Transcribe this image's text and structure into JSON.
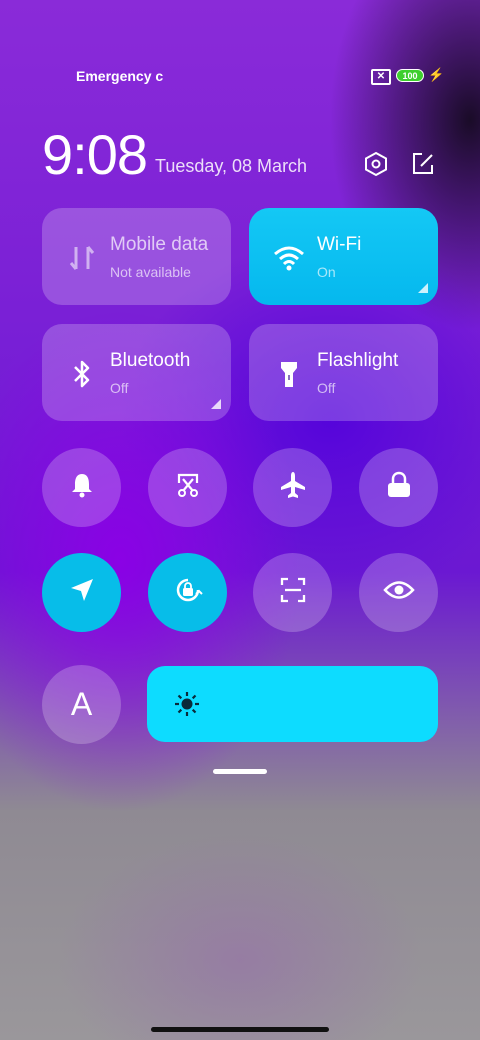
{
  "status_bar": {
    "carrier_text": "Emergency c",
    "sim_icon": "sim-error-icon",
    "battery_level": "100",
    "charging_icon": "charging-bolt-icon"
  },
  "header": {
    "time": "9:08",
    "date": "Tuesday, 08 March",
    "settings_icon": "settings-hexagon-icon",
    "edit_icon": "edit-icon"
  },
  "tiles": [
    {
      "label": "Mobile data",
      "sub": "Not available",
      "icon": "mobile-data-icon",
      "state": "disabled"
    },
    {
      "label": "Wi-Fi",
      "sub": "On",
      "icon": "wifi-icon",
      "state": "on"
    },
    {
      "label": "Bluetooth",
      "sub": "Off",
      "icon": "bluetooth-icon",
      "state": "off"
    },
    {
      "label": "Flashlight",
      "sub": "Off",
      "icon": "flashlight-icon",
      "state": "off"
    }
  ],
  "toggles_row1": [
    {
      "icon": "bell-icon",
      "state": "off"
    },
    {
      "icon": "screenshot-scissors-icon",
      "state": "off"
    },
    {
      "icon": "airplane-icon",
      "state": "off"
    },
    {
      "icon": "lock-icon",
      "state": "off"
    }
  ],
  "toggles_row2": [
    {
      "icon": "location-icon",
      "state": "on"
    },
    {
      "icon": "rotation-lock-icon",
      "state": "on"
    },
    {
      "icon": "scan-icon",
      "state": "off"
    },
    {
      "icon": "eye-icon",
      "state": "off"
    }
  ],
  "font_button": {
    "label": "A",
    "icon": "font-size-icon"
  },
  "brightness": {
    "icon": "brightness-sun-icon",
    "level": 1.0
  },
  "colors": {
    "accent_on": "#07bde9",
    "brightness_fill": "#0ddcff"
  }
}
